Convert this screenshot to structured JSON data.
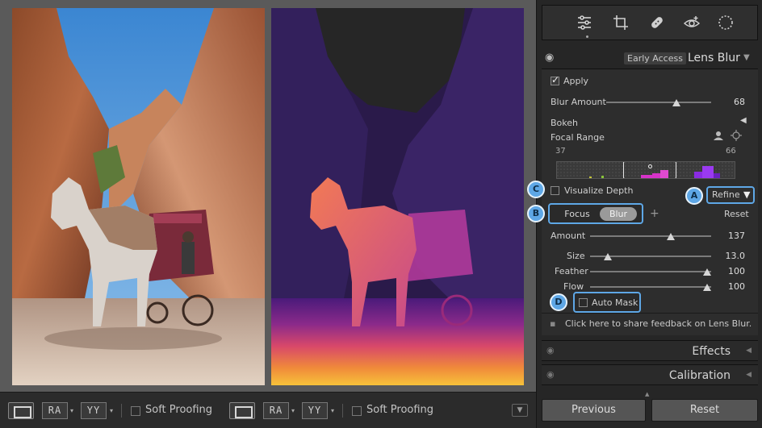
{
  "toolbar": {
    "before_after_left": "RA",
    "before_after_right": "YY",
    "soft_proofing_label_1": "Soft Proofing",
    "before_after_left_2": "RA",
    "before_after_right_2": "YY",
    "soft_proofing_label_2": "Soft Proofing",
    "caret": "▾",
    "dropdown_glyph": "▼"
  },
  "tools": {
    "icons": [
      "sliders-icon",
      "crop-icon",
      "heal-icon",
      "redeye-icon",
      "masking-icon"
    ]
  },
  "lens_blur": {
    "early_access": "Early Access",
    "title": "Lens Blur",
    "apply_label": "Apply",
    "blur_amount_label": "Blur Amount",
    "blur_amount_value": "68",
    "blur_amount_fraction": 0.68,
    "bokeh_label": "Bokeh",
    "focal_range_label": "Focal Range",
    "focal_min": "37",
    "focal_max": "66",
    "visualize_depth_label": "Visualize Depth",
    "refine_label": "Refine",
    "focus_label": "Focus",
    "blur_label": "Blur",
    "add_glyph": "+",
    "reset_label": "Reset",
    "amount_label": "Amount",
    "amount_value": "137",
    "size_label": "Size",
    "size_value": "13.0",
    "feather_label": "Feather",
    "feather_value": "100",
    "flow_label": "Flow",
    "flow_value": "100",
    "auto_mask_label": "Auto Mask"
  },
  "callouts": {
    "a": "A",
    "b": "B",
    "c": "C",
    "d": "D"
  },
  "feedback": {
    "text": "Click here to share feedback on Lens Blur."
  },
  "sections": {
    "effects": "Effects",
    "calibration": "Calibration"
  },
  "bottom": {
    "previous": "Previous",
    "reset": "Reset"
  },
  "colors": {
    "accent": "#5ea7e6",
    "panel_bg": "#2d2d2d",
    "depth_purple": "#8a2be2",
    "depth_magenta": "#d633c8"
  }
}
